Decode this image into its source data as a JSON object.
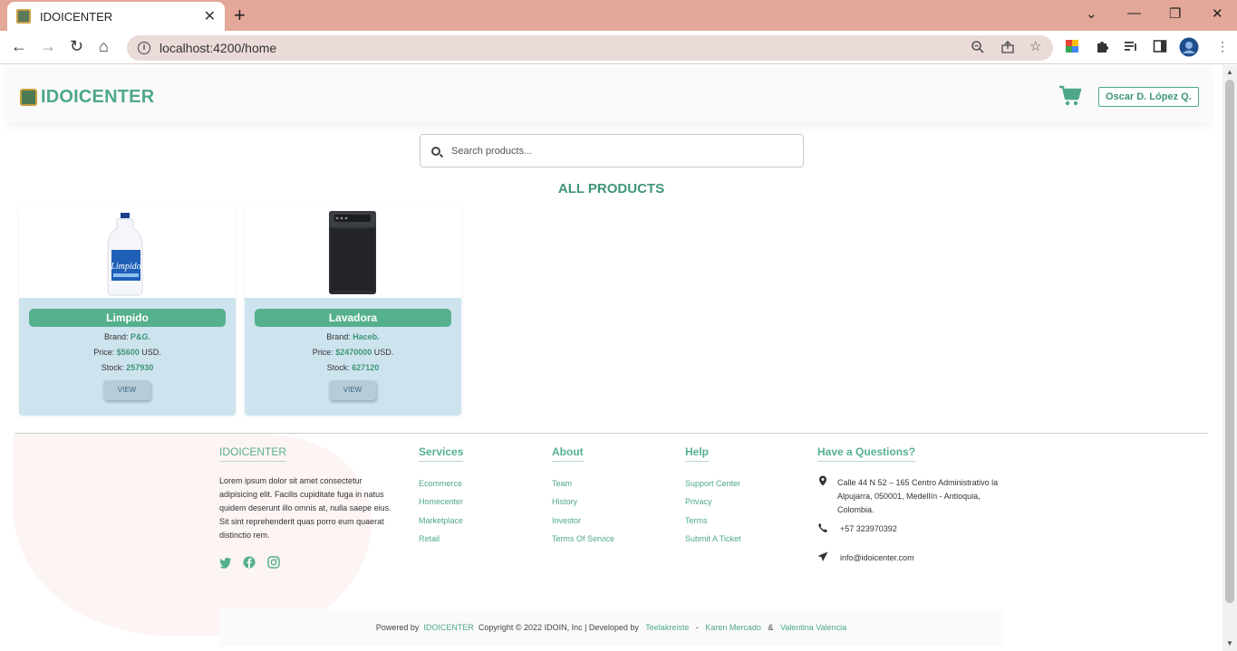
{
  "browser": {
    "tab_title": "IDOICENTER",
    "url": "localhost:4200/home"
  },
  "header": {
    "brand": "IDOICENTER",
    "user_name": "Oscar D. López Q."
  },
  "search": {
    "placeholder": "Search products..."
  },
  "section_title": "ALL PRODUCTS",
  "products": [
    {
      "name": "Limpido",
      "brand_label": "Brand:",
      "brand": "P&G.",
      "price_label": "Price:",
      "price": "$5600",
      "currency": "USD.",
      "stock_label": "Stock:",
      "stock": "257930",
      "button": "VIEW"
    },
    {
      "name": "Lavadora",
      "brand_label": "Brand:",
      "brand": "Haceb.",
      "price_label": "Price:",
      "price": "$2470000",
      "currency": "USD.",
      "stock_label": "Stock:",
      "stock": "627120",
      "button": "VIEW"
    }
  ],
  "footer": {
    "brand": "IDOICENTER",
    "description": "Lorem ipsum dolor sit amet consectetur adipisicing elit. Facilis cupiditate fuga in natus quidem deserunt illo omnis at, nulla saepe eius. Sit sint reprehenderit quas porro eum quaerat distinctio rem.",
    "services": {
      "title": "Services",
      "links": [
        "Ecommerce",
        "Homecenter",
        "Marketplace",
        "Retail"
      ]
    },
    "about": {
      "title": "About",
      "links": [
        "Team",
        "History",
        "Investor",
        "Terms Of Service"
      ]
    },
    "help": {
      "title": "Help",
      "links": [
        "Support Center",
        "Privacy",
        "Terms",
        "Submit A Ticket"
      ]
    },
    "contact": {
      "title": "Have a Questions?",
      "address": "Calle 44 N 52 – 165 Centro Administrativo la Alpujarra, 050001, Medellín - Antioquia, Colombia.",
      "phone": "+57 323970392",
      "email": "info@idoicenter.com"
    },
    "bottom": {
      "powered": "Powered by",
      "brand": "IDOICENTER",
      "copyright": "Copyright © 2022 IDOIN, Inc | Developed by",
      "dev1": "Teelakreiste",
      "sep1": "-",
      "dev2": "Karen Mercado",
      "sep2": "&",
      "dev3": "Valentina Valencia"
    }
  },
  "colors": {
    "accent": "#55b08d",
    "tab_bar": "#e3a899",
    "card_body": "#cde3ee"
  }
}
